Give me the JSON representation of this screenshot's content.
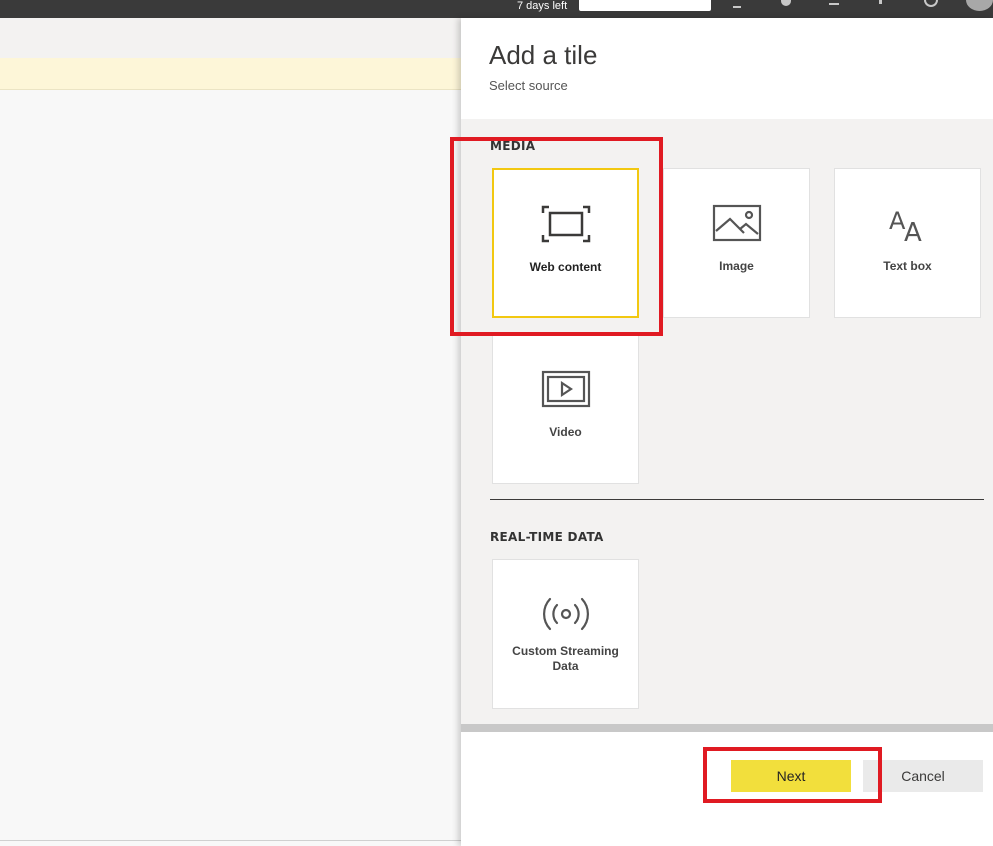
{
  "topbar": {
    "trial_text": "7 days left"
  },
  "panel": {
    "title": "Add a tile",
    "subtitle": "Select source"
  },
  "sections": {
    "media": {
      "label": "MEDIA",
      "tiles": [
        {
          "label": "Web content",
          "icon": "web-content-icon",
          "selected": true
        },
        {
          "label": "Image",
          "icon": "image-icon",
          "selected": false
        },
        {
          "label": "Text box",
          "icon": "text-box-icon",
          "selected": false
        },
        {
          "label": "Video",
          "icon": "video-icon",
          "selected": false
        }
      ]
    },
    "realtime": {
      "label": "REAL-TIME DATA",
      "tiles": [
        {
          "label": "Custom Streaming Data",
          "icon": "streaming-icon",
          "selected": false
        }
      ]
    }
  },
  "buttons": {
    "next": "Next",
    "cancel": "Cancel"
  },
  "colors": {
    "accent_yellow": "#f2c811",
    "next_button": "#f2df3c",
    "annotation_red": "#e01a22",
    "topbar": "#3a3a3a"
  }
}
